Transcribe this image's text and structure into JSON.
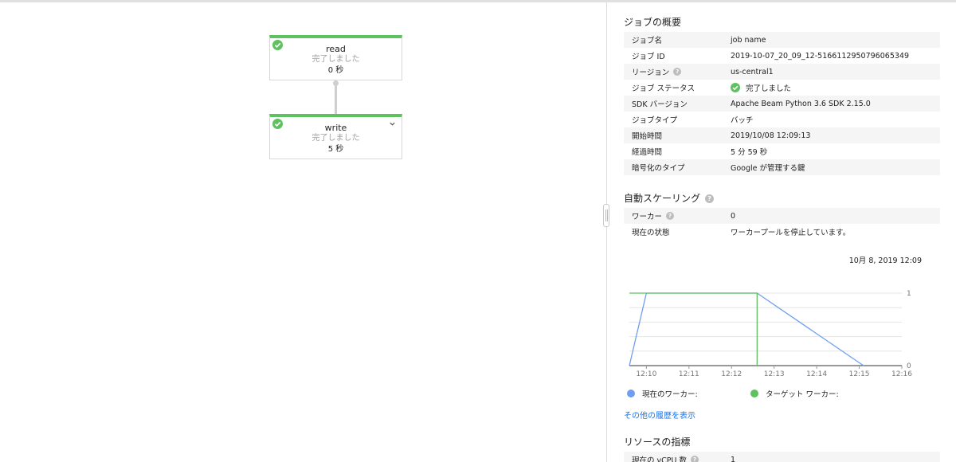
{
  "graph": {
    "steps": [
      {
        "name": "read",
        "status": "完了しました",
        "duration": "0 秒"
      },
      {
        "name": "write",
        "status": "完了しました",
        "duration": "5 秒"
      }
    ]
  },
  "job_summary": {
    "title": "ジョブの概要",
    "rows": [
      {
        "label": "ジョブ名",
        "value": "job name"
      },
      {
        "label": "ジョブ ID",
        "value": "2019-10-07_20_09_12-5166112950796065349"
      },
      {
        "label": "リージョン",
        "value": "us-central1"
      },
      {
        "label": "ジョブ ステータス",
        "value": "完了しました"
      },
      {
        "label": "SDK バージョン",
        "value": "Apache Beam Python 3.6 SDK 2.15.0"
      },
      {
        "label": "ジョブタイプ",
        "value": "バッチ"
      },
      {
        "label": "開始時間",
        "value": "2019/10/08 12:09:13"
      },
      {
        "label": "経過時間",
        "value": "5 分 59 秒"
      },
      {
        "label": "暗号化のタイプ",
        "value": "Google が管理する鍵"
      }
    ]
  },
  "autoscaling": {
    "title": "自動スケーリング",
    "rows": [
      {
        "label": "ワーカー",
        "value": "0"
      },
      {
        "label": "現在の状態",
        "value": "ワーカープールを停止しています。"
      }
    ],
    "chart_timestamp": "10月 8, 2019 12:09",
    "legend": {
      "current": "現在のワーカー:",
      "target": "ターゲット ワーカー:"
    },
    "history_link": "その他の履歴を表示"
  },
  "resources": {
    "title": "リソースの指標",
    "rows": [
      {
        "label": "現在の vCPU 数",
        "value": "1"
      }
    ]
  },
  "colors": {
    "success": "#5fc15f",
    "current_workers": "#6f9ef0",
    "target_workers": "#5fc15f",
    "link": "#1a73e8"
  },
  "chart_data": {
    "type": "line",
    "x_ticks": [
      "12:10",
      "12:11",
      "12:12",
      "12:13",
      "12:14",
      "12:15",
      "12:16"
    ],
    "y_ticks": [
      "0",
      "1"
    ],
    "ylim": [
      0,
      1
    ],
    "xlim": [
      "12:09.6",
      "12:16"
    ],
    "grid": true,
    "series": [
      {
        "name": "現在のワーカー:",
        "x": [
          "12:09.6",
          "12:10.0",
          "12:12.6",
          "12:15.1"
        ],
        "y": [
          0,
          1,
          1,
          0
        ]
      },
      {
        "name": "ターゲット ワーカー:",
        "x": [
          "12:09.6",
          "12:12.6",
          "12:12.6"
        ],
        "y": [
          1,
          1,
          0
        ]
      }
    ]
  }
}
